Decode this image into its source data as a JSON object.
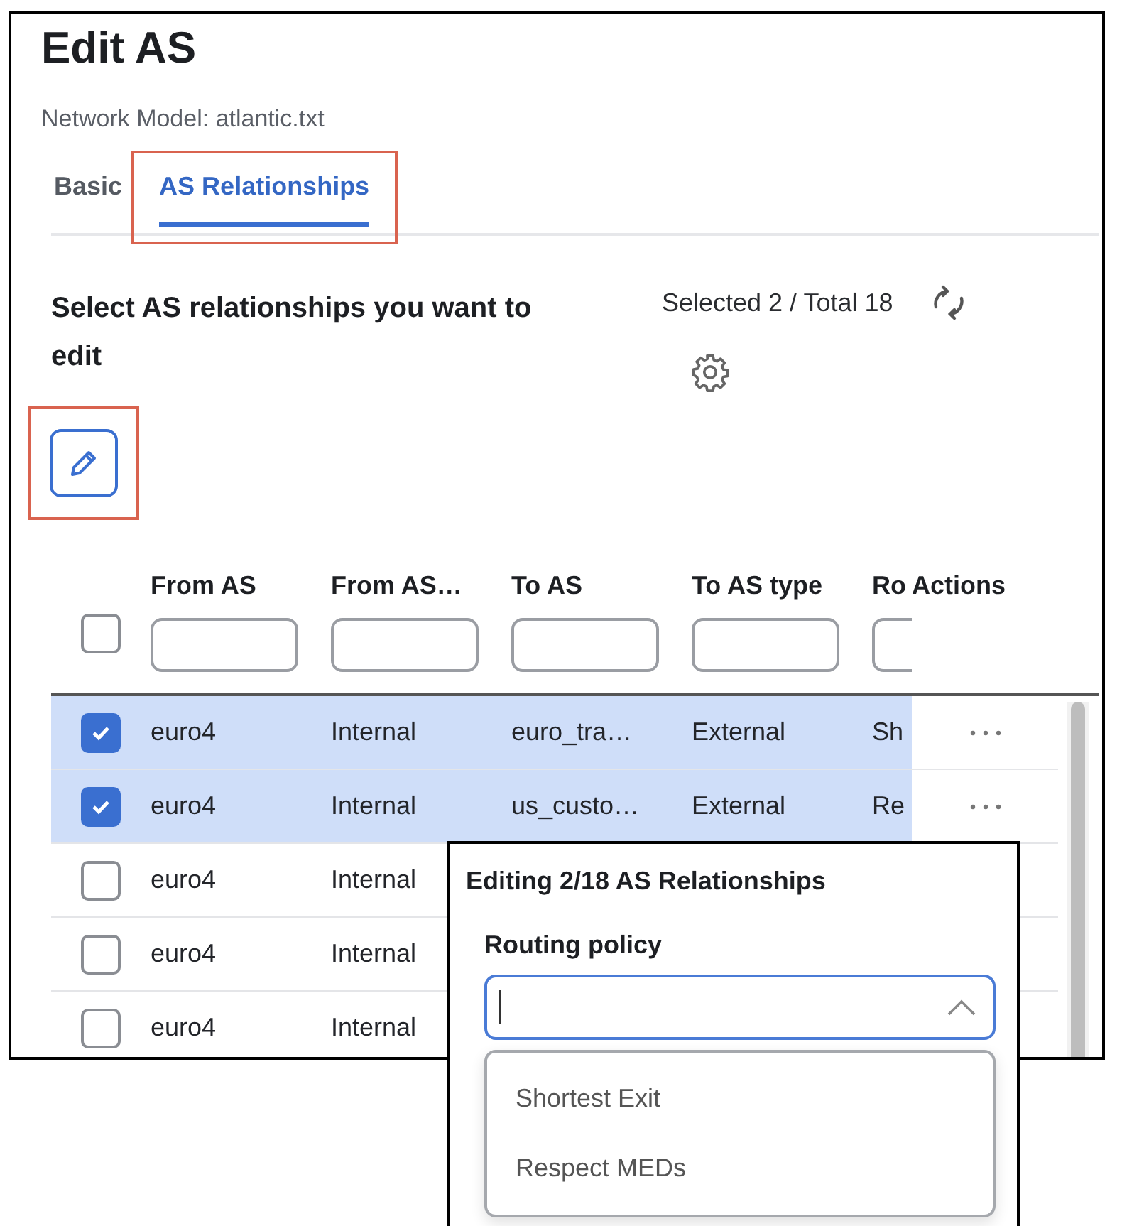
{
  "page": {
    "title": "Edit AS",
    "subtitle": "Network Model: atlantic.txt"
  },
  "tabs": [
    {
      "label": "Basic",
      "selected": false,
      "highlighted": false
    },
    {
      "label": "AS Relationships",
      "selected": true,
      "highlighted": true
    }
  ],
  "toolbar": {
    "heading": "Select AS relationships you want to edit",
    "selection_count": "Selected 2 / Total 18",
    "edit_button": {
      "highlighted": true
    }
  },
  "table": {
    "select_all": {
      "checked": false
    },
    "columns": [
      {
        "label": "From AS",
        "filter": true
      },
      {
        "label": "From AS…",
        "filter": true
      },
      {
        "label": "To AS",
        "filter": true
      },
      {
        "label": "To AS type",
        "filter": true
      },
      {
        "label": "Ro",
        "filter": true
      },
      {
        "label": "Actions",
        "filter": false
      }
    ],
    "rows": [
      {
        "selected": true,
        "cells": [
          "euro4",
          "Internal",
          "euro_tra…",
          "External",
          "Sh"
        ],
        "actions": true
      },
      {
        "selected": true,
        "cells": [
          "euro4",
          "Internal",
          "us_custo…",
          "External",
          "Re"
        ],
        "actions": true
      },
      {
        "selected": false,
        "cells": [
          "euro4",
          "Internal"
        ],
        "actions": false
      },
      {
        "selected": false,
        "cells": [
          "euro4",
          "Internal"
        ],
        "actions": false
      },
      {
        "selected": false,
        "cells": [
          "euro4",
          "Internal"
        ],
        "actions": false
      }
    ]
  },
  "edit_popup": {
    "title": "Editing 2/18 AS Relationships",
    "field_label": "Routing policy",
    "dropdown": {
      "expanded": true,
      "options": [
        "Shortest Exit",
        "Respect MEDs"
      ]
    }
  }
}
